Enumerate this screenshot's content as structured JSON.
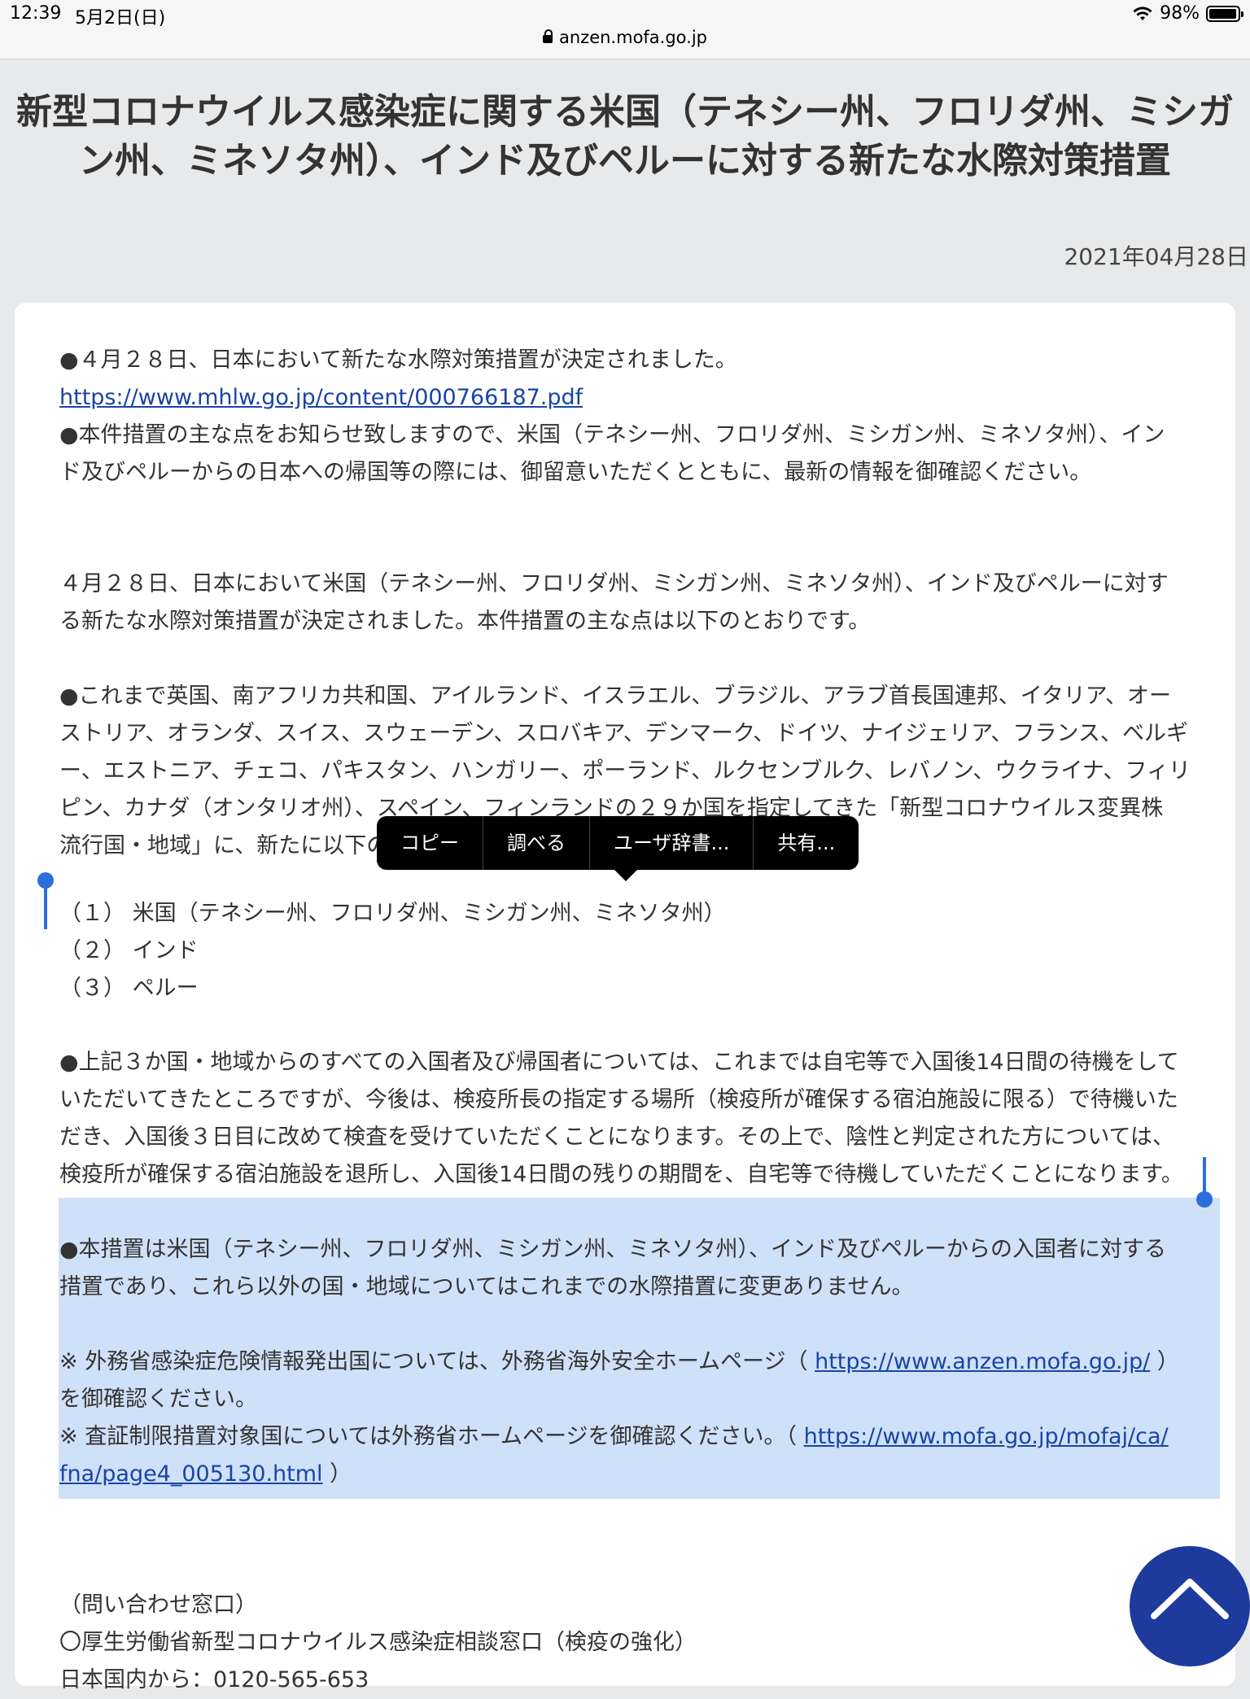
{
  "status_bar": {
    "time": "12:39",
    "date": "5月2日(日)",
    "url": "anzen.mofa.go.jp",
    "battery": "98%"
  },
  "article": {
    "title_line1": "新型コロナウイルス感染症に関する米国（テネシー州、フロリダ州、ミシガ",
    "title_line2": "ン州、ミネソタ州）、インド及びペルーに対する新たな水際対策措置",
    "date": "2021年04月28日",
    "p1_line1": "●４月２８日、日本において新たな水際対策措置が決定されました。",
    "p1_link": "https://www.mhlw.go.jp/content/000766187.pdf",
    "p1_line3": "●本件措置の主な点をお知らせ致しますので、米国（テネシー州、フロリダ州、ミシガン州、ミネソタ州）、イン",
    "p1_line4": "ド及びペルーからの日本への帰国等の際には、御留意いただくとともに、最新の情報を御確認ください。",
    "p2_line1": "４月２８日、日本において米国（テネシー州、フロリダ州、ミシガン州、ミネソタ州）、インド及びペルーに対す",
    "p2_line2": "る新たな水際対策措置が決定されました。本件措置の主な点は以下のとおりです。",
    "p3_line1": "●これまで英国、南アフリカ共和国、アイルランド、イスラエル、ブラジル、アラブ首長国連邦、イタリア、オー",
    "p3_line2": "ストリア、オランダ、スイス、スウェーデン、スロバキア、デンマーク、ドイツ、ナイジェリア、フランス、ベルギ",
    "p3_line3": "ー、エストニア、チェコ、パキスタン、ハンガリー、ポーランド、ルクセンブルク、レバノン、ウクライナ、フィリ",
    "p3_line4": "ピン、カナダ（オンタリオ州）、スペイン、フィンランドの２９か国を指定してきた「新型コロナウイルス変異株",
    "p3_line5": "流行国・地域」に、新たに以下の",
    "item1": "（１） 米国（テネシー州、フロリダ州、ミシガン州、ミネソタ州）",
    "item2": "（２） インド",
    "item3": "（３） ペルー",
    "p4_line1": "●上記３か国・地域からのすべての入国者及び帰国者については、これまでは自宅等で入国後14日間の待機をして",
    "p4_line2": "いただいてきたところですが、今後は、検疫所長の指定する場所（検疫所が確保する宿泊施設に限る）で待機いた",
    "p4_line3": "だき、入国後３日目に改めて検査を受けていただくことになります。その上で、陰性と判定された方については、",
    "p4_line4": "検疫所が確保する宿泊施設を退所し、入国後14日間の残りの期間を、自宅等で待機していただくことになります。",
    "p5_line1": "●本措置は米国（テネシー州、フロリダ州、ミシガン州、ミネソタ州）、インド及びペルーからの入国者に対する",
    "p5_line2": "措置であり、これら以外の国・地域についてはこれまでの水際措置に変更ありません。",
    "note1_prefix": "※ 外務省感染症危険情報発出国については、外務省海外安全ホームページ（ ",
    "note1_link": "https://www.anzen.mofa.go.jp/",
    "note1_suffix": " ）",
    "note1_line2": "を御確認ください。",
    "note2_prefix": "※ 査証制限措置対象国については外務省ホームページを御確認ください。（ ",
    "note2_link_part1": "https://www.mofa.go.jp/mofaj/ca/",
    "note2_link_part2": "fna/page4_005130.html",
    "note2_suffix": " ）",
    "contact_heading": "（問い合わせ窓口）",
    "contact_line1": "〇厚生労働省新型コロナウイルス感染症相談窓口（検疫の強化）",
    "contact_line2": "日本国内から：0120-565-653"
  },
  "context_menu": {
    "items": [
      "コピー",
      "調べる",
      "ユーザ辞書...",
      "共有..."
    ]
  },
  "colors": {
    "page_bg": "#e8e9ea",
    "link": "#1a44a6",
    "selection": "#cfe1f8",
    "selection_handle": "#2a6fdb",
    "scroll_button": "#1d3a9c"
  },
  "icons": [
    "lock-icon",
    "wifi-icon",
    "battery-icon",
    "chevron-up-icon"
  ]
}
